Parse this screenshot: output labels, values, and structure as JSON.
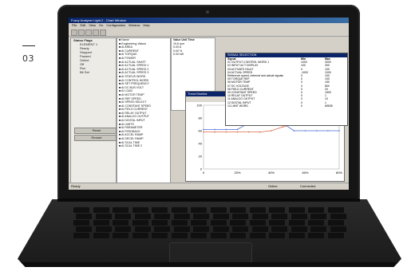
{
  "page": {
    "number": "03"
  },
  "app": {
    "title": "Fuzzy Analyzer Light 2 - Chart Window",
    "menu": [
      "File",
      "Edit",
      "View",
      "Go",
      "Configuration",
      "Window",
      "Help"
    ],
    "left_panel": {
      "heading": "Status Flags",
      "items": [
        "ELEMENT 1",
        "Ready",
        "Stopped",
        "Paused",
        "Online",
        "Off",
        "Run",
        "Bit Set"
      ],
      "buttons": [
        "Reset",
        "Restart"
      ]
    },
    "tree": {
      "rows": [
        "Name",
        "Engineering Values",
        "AI AREA",
        "AI CURRENT",
        "AI TORQUE",
        "AI POWER",
        "AI ACTUAL SHAFT",
        "AI ACTUAL SPEED 1",
        "AI ACTUAL SPEED 2",
        "AI ACTUAL SPEED 3",
        "AI STATUS WORD",
        "AI CONTROL WORD",
        "AI SET FREQUENCY",
        "AI DC BUS VOLT",
        "AI LOAD",
        "AI MOTOR TEMP",
        "AI REF SPEED",
        "AI SPEED SELECT",
        "AI CONSTANT SPEED",
        "AI FIELD CURRENT",
        "AI RELAY OUTPUT",
        "AI ANALOG OUTPUT",
        "AI DIGITAL INPUT",
        "AI LIMITS",
        "AI PARAMETER",
        "AI FEEDBACK",
        "AI ACCEL RAMP",
        "AI DECEL RAMP",
        "AI SCAL TIME",
        "AI SCAL TIME 2"
      ]
    },
    "grid": {
      "headers": [
        "Value",
        "Unit",
        "Time"
      ],
      "rows": [
        [
          "19.6",
          "rpm"
        ],
        [
          "0.00",
          "A"
        ],
        [
          "0.00",
          "%"
        ],
        [
          "0.00",
          "kW"
        ]
      ]
    },
    "dialog": {
      "title": "SIGNAL SELECTION",
      "headers": [
        "Signal",
        "Min",
        "Max"
      ],
      "rows": [
        [
          "01 OUTPUT CONTROL WORD 1",
          "1000",
          "3000"
        ],
        [
          "02 INPUT ACT DISPLAY",
          "100",
          "300"
        ],
        [
          "03 ACTIVATE FAULT",
          "0",
          "100"
        ],
        [
          "04 ACTUAL SPEED",
          "-1000",
          "1000"
        ],
        [
          "Reference speed, external and actual signals",
          "0",
          "100"
        ],
        [
          "05 TORQUE REF",
          "0",
          "100"
        ],
        [
          "06 MOTOR TEMP",
          "0",
          "150"
        ],
        [
          "07 DC VOLTAGE",
          "0",
          "800"
        ],
        [
          "08 FIELD CURRENT",
          "0",
          "20"
        ],
        [
          "09 CONSTANT SPEED",
          "0",
          "1500"
        ],
        [
          "10 RELAY OUTPUT",
          "0",
          "1"
        ],
        [
          "11 ANALOG OUTPUT",
          "0",
          "10"
        ],
        [
          "12 DIGITAL INPUT",
          "0",
          "1"
        ],
        [
          "13 LIMIT WORD",
          "0",
          "65535"
        ]
      ]
    },
    "plot": {
      "title": "Trend Monitor",
      "x_ticks": [
        "0",
        "20%",
        "40%",
        "60%",
        "80%"
      ],
      "y_ticks": [
        "100",
        "80",
        "60",
        "40",
        "20",
        "0"
      ]
    },
    "status": {
      "left": "Ready",
      "right_a": "Online",
      "right_b": "Connected"
    }
  },
  "chart_data": {
    "type": "line",
    "x": [
      0,
      1,
      2,
      3,
      4,
      5,
      6,
      7,
      8,
      9,
      10,
      11,
      12
    ],
    "series": [
      {
        "name": "",
        "color": "#4a6cd4",
        "values": [
          62,
          62,
          62,
          62,
          72,
          72,
          72,
          72,
          60,
          60,
          60,
          60,
          60
        ]
      },
      {
        "name": "",
        "color": "#d86a4a",
        "values": [
          58,
          58,
          58,
          58,
          58,
          58,
          60,
          66,
          70,
          70,
          70,
          70,
          70
        ]
      }
    ],
    "ylim": [
      0,
      100
    ]
  }
}
